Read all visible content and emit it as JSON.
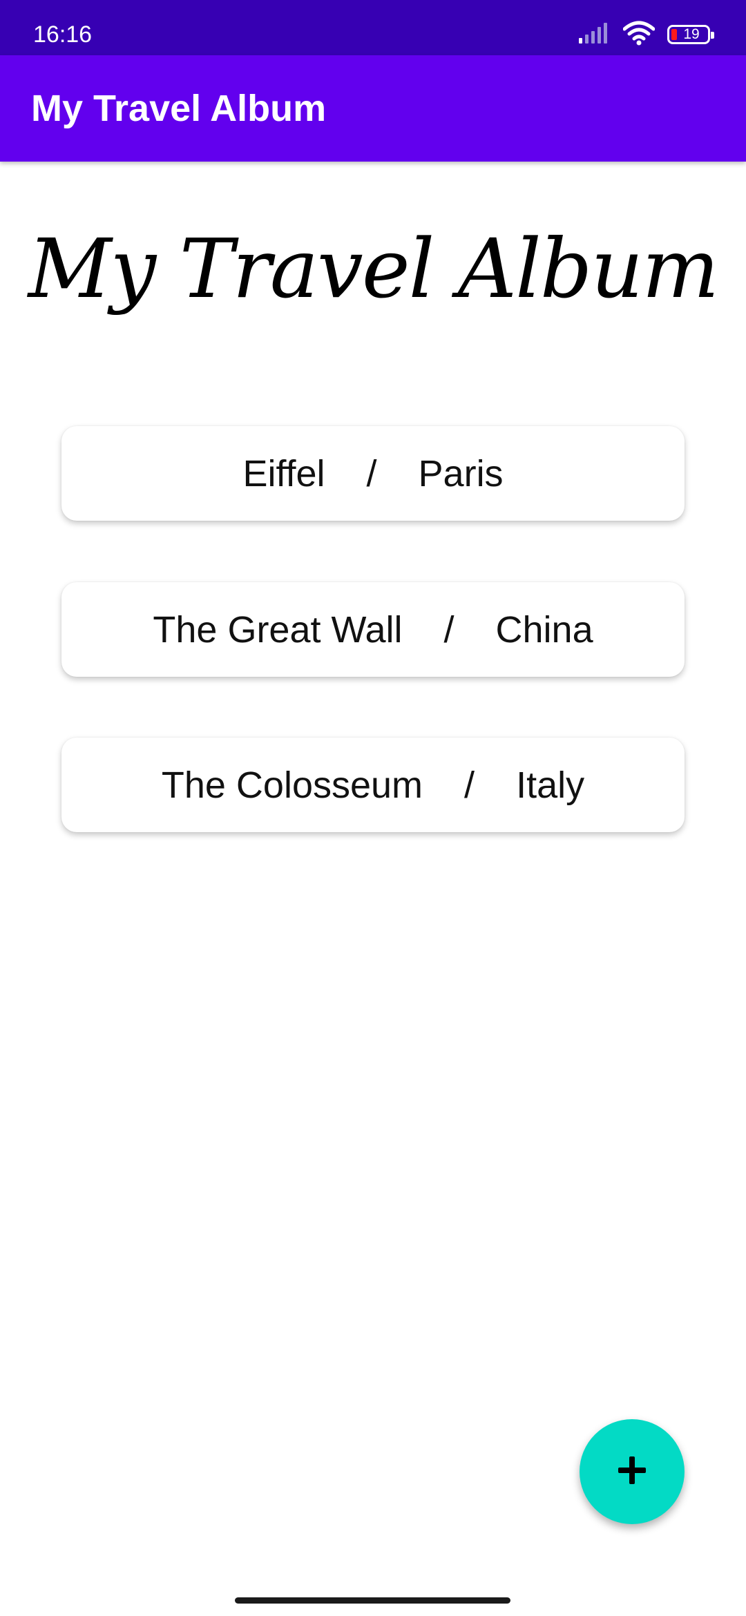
{
  "status_bar": {
    "time": "16:16",
    "battery_level": "19"
  },
  "app_bar": {
    "title": "My Travel Album"
  },
  "hero": {
    "title": "My Travel Album"
  },
  "places": [
    {
      "name": "Eiffel",
      "separator": "/",
      "location": "Paris"
    },
    {
      "name": "The Great Wall",
      "separator": "/",
      "location": "China"
    },
    {
      "name": "The Colosseum",
      "separator": "/",
      "location": "Italy"
    }
  ],
  "fab": {
    "icon": "plus-icon"
  },
  "colors": {
    "status_bar": "#3700b3",
    "app_bar": "#6200ee",
    "fab": "#03dac5",
    "battery_low": "#ff1a1a"
  }
}
